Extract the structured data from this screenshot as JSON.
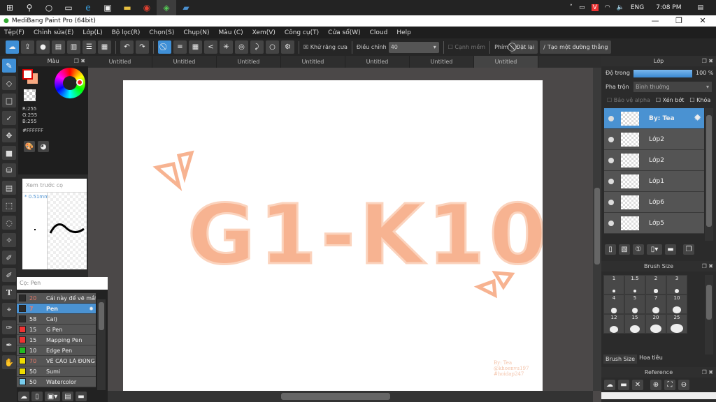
{
  "taskbar": {
    "icons": [
      "windows-icon",
      "search-icon",
      "cortana-icon",
      "task-view-icon",
      "edge-icon",
      "store-icon",
      "explorer-icon",
      "chrome-icon",
      "medibang-icon",
      "app-icon"
    ],
    "tray": {
      "lang": "ENG",
      "time": "7:08 PM"
    }
  },
  "window": {
    "title": "MediBang Paint Pro (64bit)",
    "minimize": "—",
    "maximize": "❐",
    "close": "✕"
  },
  "menu": [
    "Tệp(F)",
    "Chỉnh sửa(E)",
    "Lớp(L)",
    "Bộ lọc(R)",
    "Chọn(S)",
    "Chụp(N)",
    "Màu (C)",
    "Xem(V)",
    "Công cụ(T)",
    "Cửa sổ(W)",
    "Cloud",
    "Help"
  ],
  "toolbar": {
    "antialias": "Khử răng cưa",
    "adjust_label": "Điều chỉnh",
    "adjust_value": "40",
    "soft_edge": "Cạnh mềm",
    "keys_label": "Phím",
    "reset": "Đặt lại",
    "straight_line": "Tạo một đường thẳng"
  },
  "tabs": [
    "Untitled",
    "Untitled",
    "Untitled",
    "Untitled",
    "Untitled",
    "Untitled",
    "Untitled"
  ],
  "active_tab": 6,
  "color_panel": {
    "title": "Màu",
    "r": "R:255",
    "g": "G:255",
    "b": "B:255",
    "hex": "#FFFFFF",
    "foreground": "#ffffff",
    "background": "#f7a982"
  },
  "preview": {
    "title": "Xem trước cọ",
    "size": "* 0.51mm"
  },
  "brush_panel": {
    "title": "Cọ: Pen",
    "items": [
      {
        "size": "20",
        "name": "Cái này để vẽ mắt",
        "color": "#2a2a2a",
        "size_color": "#e87a6a"
      },
      {
        "size": "7",
        "name": "Pen",
        "color": "#2a2a2a",
        "size_color": "#e87a6a",
        "selected": true
      },
      {
        "size": "58",
        "name": "Cal)",
        "color": "#2a2a2a",
        "size_color": "#eeeeee"
      },
      {
        "size": "15",
        "name": "G Pen",
        "color": "#ee3333",
        "size_color": "#eeeeee"
      },
      {
        "size": "15",
        "name": "Mapping Pen",
        "color": "#ee3333",
        "size_color": "#eeeeee"
      },
      {
        "size": "10",
        "name": "Edge Pen",
        "color": "#22bb22",
        "size_color": "#eeeeee"
      },
      {
        "size": "70",
        "name": "VẼ CẢO LÀ ĐÚNG",
        "color": "#eedd00",
        "size_color": "#e87a6a"
      },
      {
        "size": "50",
        "name": "Sumi",
        "color": "#eedd00",
        "size_color": "#eeeeee"
      },
      {
        "size": "50",
        "name": "Watercolor",
        "color": "#77ccee",
        "size_color": "#eeeeee"
      }
    ]
  },
  "artwork": {
    "main_text": "G1-K10",
    "signature": [
      "By: Tea",
      "@khoenvu197",
      "#hoidap247"
    ],
    "color": "#f7b391"
  },
  "layer_panel": {
    "title": "Lớp",
    "opacity_label": "Độ trong",
    "opacity": "100 %",
    "opacity_value": 100,
    "blend_label": "Pha trộn",
    "blend_value": "Bình thường",
    "protect_alpha": "Bảo vệ alpha",
    "clip": "Xén bớt",
    "lock": "Khóa",
    "layers": [
      {
        "name": "By: Tea",
        "selected": true
      },
      {
        "name": "Lớp2"
      },
      {
        "name": "Lớp2"
      },
      {
        "name": "Lớp1"
      },
      {
        "name": "Lớp6"
      },
      {
        "name": "Lớp5"
      }
    ]
  },
  "brush_size": {
    "title": "Brush Size",
    "sizes": [
      "1",
      "1.5",
      "2",
      "3",
      "4",
      "5",
      "7",
      "10",
      "12",
      "15",
      "20",
      "25"
    ],
    "tabs": [
      "Brush Size",
      "Hoa tiêu"
    ]
  },
  "reference": {
    "title": "Reference"
  }
}
